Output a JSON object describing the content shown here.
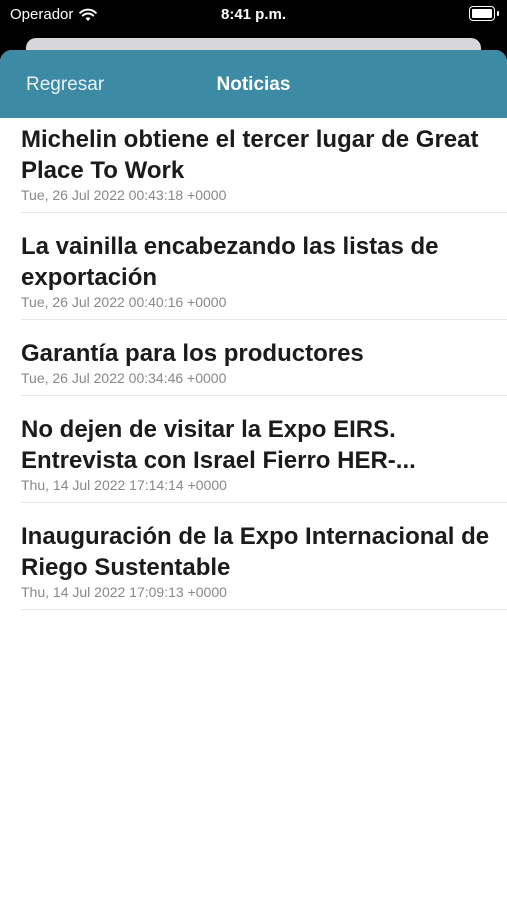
{
  "status": {
    "carrier": "Operador",
    "time": "8:41 p.m."
  },
  "nav": {
    "back_label": "Regresar",
    "title": "Noticias"
  },
  "news": [
    {
      "title": "Michelin obtiene el tercer lugar de Great Place To Work",
      "date": "Tue, 26 Jul 2022 00:43:18 +0000"
    },
    {
      "title": "La vainilla encabezando las listas de exportación",
      "date": "Tue, 26 Jul 2022 00:40:16 +0000"
    },
    {
      "title": "Garantía para los productores",
      "date": "Tue, 26 Jul 2022 00:34:46 +0000"
    },
    {
      "title": "No dejen de visitar la Expo EIRS. Entrevista con Israel Fierro HER-...",
      "date": "Thu, 14 Jul 2022 17:14:14 +0000"
    },
    {
      "title": "Inauguración de la Expo Internacional de Riego Sustentable",
      "date": "Thu, 14 Jul 2022 17:09:13 +0000"
    }
  ],
  "colors": {
    "nav_background": "#3d8aa5",
    "title_text": "#1b1b1b",
    "date_text": "#888888"
  }
}
